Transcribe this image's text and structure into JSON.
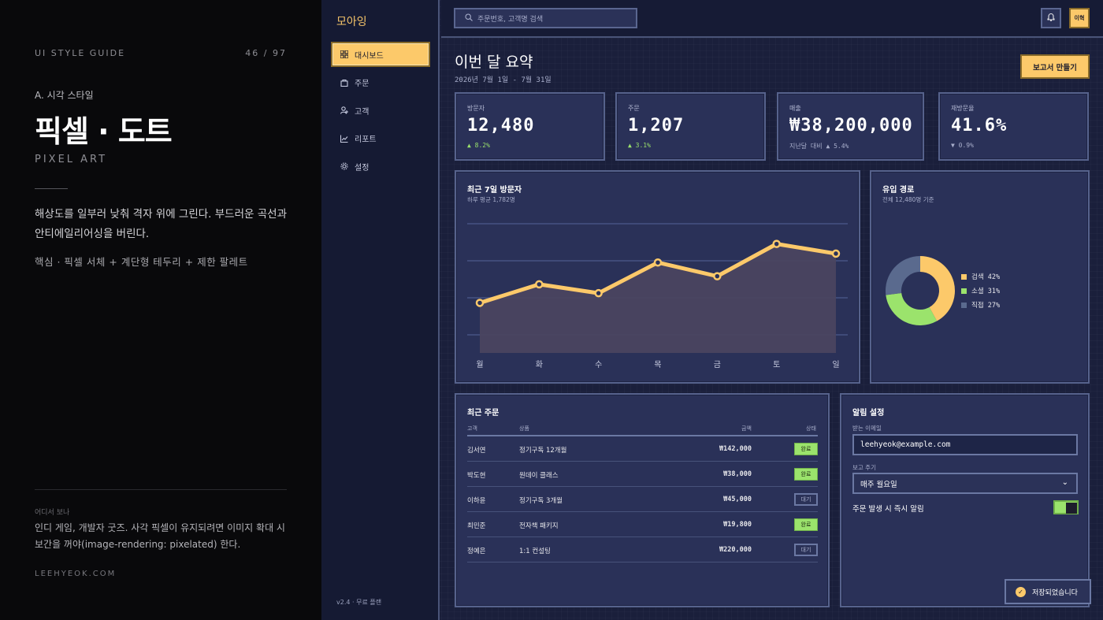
{
  "guide": {
    "header_left": "UI STYLE GUIDE",
    "header_right": "46 / 97",
    "section": "A. 시각 스타일",
    "title": "픽셀 · 도트",
    "title_en": "PIXEL ART",
    "description": "해상도를 일부러 낮춰 격자 위에 그린다. 부드러운 곡선과 안티에일리어싱을 버린다.",
    "key_points": "핵심 · 픽셀 서체 + 계단형 테두리 + 제한 팔레트",
    "where_label": "어디서 보나",
    "where_text": "인디 게임, 개발자 굿즈. 사각 픽셀이 유지되려면 이미지 확대 시 보간을 꺼야(image-rendering: pixelated) 한다.",
    "site": "LEEHYEOK.COM"
  },
  "sidebar": {
    "brand": "모아잉",
    "items": [
      {
        "label": "대시보드",
        "icon": "grid-icon"
      },
      {
        "label": "주문",
        "icon": "bag-icon"
      },
      {
        "label": "고객",
        "icon": "user-icon"
      },
      {
        "label": "리포트",
        "icon": "chart-icon"
      },
      {
        "label": "설정",
        "icon": "gear-icon"
      }
    ],
    "version": "v2.4 · 무료 플랜"
  },
  "topbar": {
    "search_placeholder": "주문번호, 고객명 검색",
    "avatar": "이혁"
  },
  "header": {
    "title": "이번 달 요약",
    "date": "2026년 7월 1일 - 7월 31일",
    "report_button": "보고서 만들기"
  },
  "kpis": [
    {
      "label": "방문자",
      "value": "12,480",
      "change": "▲ 8.2%",
      "trend": "up"
    },
    {
      "label": "주문",
      "value": "1,207",
      "change": "▲ 3.1%",
      "trend": "up"
    },
    {
      "label": "매출",
      "value": "₩38,200,000",
      "change_prefix": "지난달 대비",
      "change": "▲ 5.4%",
      "trend": "up"
    },
    {
      "label": "재방문율",
      "value": "41.6%",
      "change": "▼ 0.9%",
      "trend": "down"
    }
  ],
  "visitors_chart": {
    "title": "최근 7일 방문자",
    "subtitle": "하루 평균 1,782명"
  },
  "traffic_chart": {
    "title": "유입 경로",
    "subtitle": "전체 12,480명 기준"
  },
  "chart_data": [
    {
      "type": "area",
      "title": "최근 7일 방문자",
      "categories": [
        "월",
        "화",
        "수",
        "목",
        "금",
        "토",
        "일"
      ],
      "values": [
        1520,
        1750,
        1640,
        2020,
        1850,
        2250,
        2130
      ],
      "ylim": [
        900,
        2500
      ],
      "grid": true,
      "color": "#fcc96a"
    },
    {
      "type": "pie",
      "title": "유입 경로",
      "categories": [
        "검색",
        "소셜",
        "직접"
      ],
      "values": [
        42,
        31,
        27
      ],
      "labels": [
        "검색 42%",
        "소셜 31%",
        "직접 27%"
      ],
      "colors": [
        "#fcc96a",
        "#9be36c",
        "#5a6a8e"
      ]
    }
  ],
  "orders": {
    "title": "최근 주문",
    "columns": [
      "고객",
      "상품",
      "금액",
      "상태"
    ],
    "rows": [
      {
        "customer": "김서연",
        "product": "정기구독 12개월",
        "amount": "₩142,000",
        "status": "완료",
        "state": "done"
      },
      {
        "customer": "박도현",
        "product": "원데이 클래스",
        "amount": "₩38,000",
        "status": "완료",
        "state": "done"
      },
      {
        "customer": "이하윤",
        "product": "정기구독 3개월",
        "amount": "₩45,000",
        "status": "대기",
        "state": "wait"
      },
      {
        "customer": "최민준",
        "product": "전자책 패키지",
        "amount": "₩19,800",
        "status": "완료",
        "state": "done"
      },
      {
        "customer": "정예은",
        "product": "1:1 컨설팅",
        "amount": "₩220,000",
        "status": "대기",
        "state": "wait"
      }
    ]
  },
  "settings": {
    "title": "알림 설정",
    "email_label": "받는 이메일",
    "email_value": "leehyeok@example.com",
    "cycle_label": "보고 주기",
    "cycle_value": "매주 월요일",
    "toggle_label": "주문 발생 시 즉시 알림",
    "toggle_on": true
  },
  "toast": {
    "message": "저장되었습니다"
  }
}
